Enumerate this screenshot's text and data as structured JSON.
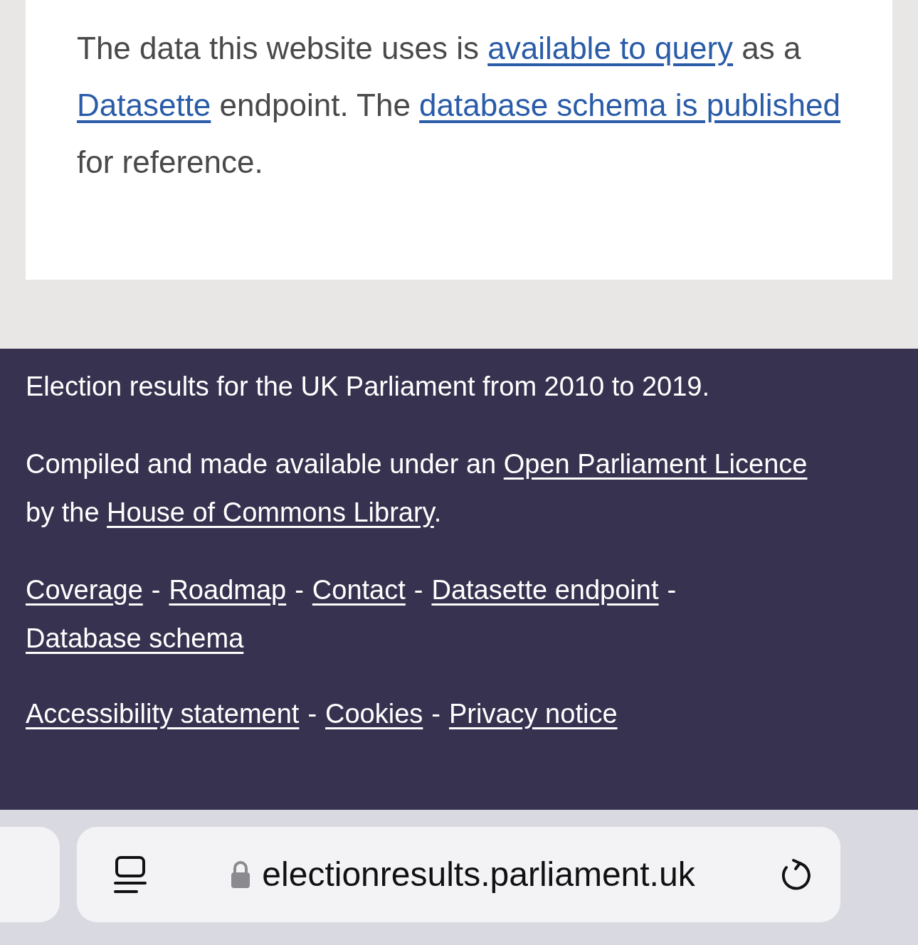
{
  "intro": {
    "segments": [
      {
        "text": "The data this website uses is ",
        "link": false
      },
      {
        "text": "available to query",
        "link": true
      },
      {
        "text": " as a ",
        "link": false
      },
      {
        "text": "Datasette",
        "link": true
      },
      {
        "text": " endpoint. The ",
        "link": false
      },
      {
        "text": "database schema is published",
        "link": true
      },
      {
        "text": " for reference.",
        "link": false
      }
    ]
  },
  "footer": {
    "summary": "Election results for the UK Parliament from 2010 to 2019.",
    "licence": {
      "segments": [
        {
          "text": "Compiled and made available under an ",
          "link": false
        },
        {
          "text": "Open Parliament Licence",
          "link": true
        },
        {
          "text": " by the ",
          "link": false
        },
        {
          "text": "House of Commons Library",
          "link": true
        },
        {
          "text": ".",
          "link": false
        }
      ]
    },
    "nav_links": [
      "Coverage",
      "Roadmap",
      "Contact",
      "Datasette endpoint",
      "Database schema"
    ],
    "legal_links": [
      "Accessibility statement",
      "Cookies",
      "Privacy notice"
    ],
    "separator": "-"
  },
  "browser_bar": {
    "url": "electionresults.parliament.uk"
  }
}
